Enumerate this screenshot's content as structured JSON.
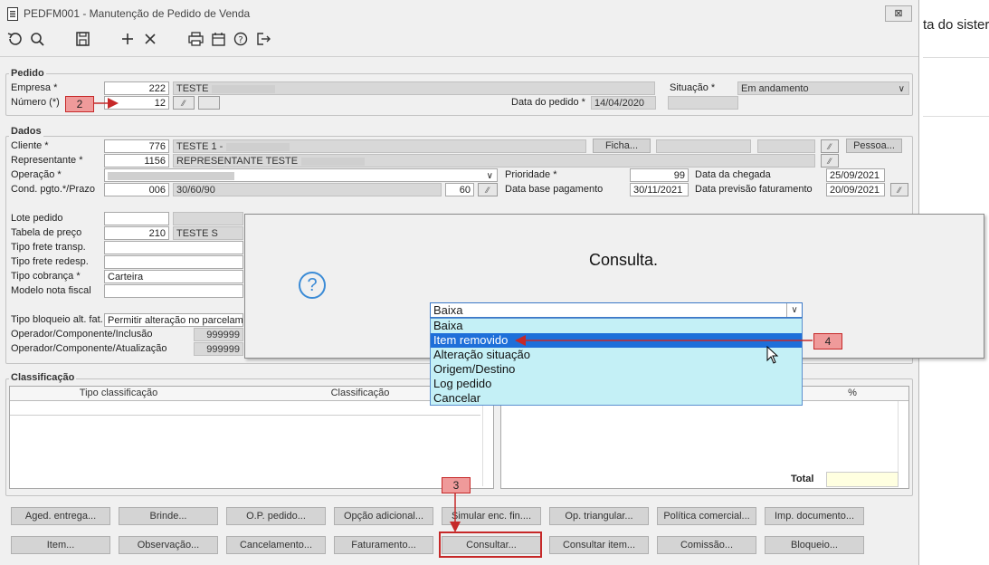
{
  "window": {
    "title": "PEDFM001 - Manutenção de Pedido de Venda",
    "close_label": "⊠"
  },
  "toolbar": {
    "icons": [
      "undo-icon",
      "search-icon",
      "save-icon",
      "add-icon",
      "delete-icon",
      "print-icon",
      "calendar-icon",
      "help-icon",
      "exit-icon"
    ]
  },
  "pedido": {
    "group": "Pedido",
    "empresa_label": "Empresa *",
    "empresa_code": "222",
    "empresa_name": "TESTE",
    "numero_label": "Número (*)",
    "numero_value": "12",
    "situacao_label": "Situação *",
    "situacao_value": "Em andamento",
    "data_label": "Data do pedido *",
    "data_value": "14/04/2020"
  },
  "dados": {
    "group": "Dados",
    "cliente_label": "Cliente *",
    "cliente_code": "776",
    "cliente_name": "TESTE 1 -",
    "ficha_label": "Ficha...",
    "pessoa_label": "Pessoa...",
    "representante_label": "Representante *",
    "representante_code": "1156",
    "representante_name": "REPRESENTANTE TESTE",
    "operacao_label": "Operação *",
    "cond_label": "Cond. pgto.*/Prazo",
    "cond_code": "006",
    "cond_desc": "30/60/90",
    "prazo": "60",
    "prioridade_label": "Prioridade *",
    "prioridade_value": "99",
    "data_base_label": "Data base pagamento",
    "data_base_value": "30/11/2021",
    "data_chegada_label": "Data da chegada",
    "data_chegada_value": "25/09/2021",
    "data_prev_label": "Data previsão faturamento",
    "data_prev_value": "20/09/2021",
    "lote_label": "Lote pedido",
    "tabela_label": "Tabela de preço",
    "tabela_code": "210",
    "tabela_name": "TESTE S",
    "frete_transp_label": "Tipo frete transp.",
    "frete_redesp_label": "Tipo frete redesp.",
    "cobranca_label": "Tipo cobrança *",
    "cobranca_value": "Carteira",
    "modelo_label": "Modelo nota fiscal",
    "bloqueio_label": "Tipo bloqueio alt. fat.",
    "bloqueio_value": "Permitir alteração no parcelame",
    "op_inclusao_label": "Operador/Componente/Inclusão",
    "op_inclusao_value": "999999",
    "op_atualizacao_label": "Operador/Componente/Atualização",
    "op_atualizacao_value": "999999"
  },
  "classificacao": {
    "group": "Classificação",
    "col1": "Tipo classificação",
    "col2": "Classificação",
    "pct_header": "%",
    "total_label": "Total"
  },
  "buttons_row1": [
    "Aged. entrega...",
    "Brinde...",
    "O.P. pedido...",
    "Opção adicional...",
    "Simular enc. fin....",
    "Op. triangular...",
    "Política comercial...",
    "Imp. documento..."
  ],
  "buttons_row2": [
    "Item...",
    "Observação...",
    "Cancelamento...",
    "Faturamento...",
    "Consultar...",
    "Consultar item...",
    "Comissão...",
    "Bloqueio..."
  ],
  "dialog": {
    "title": "Consulta.",
    "selected": "Baixa",
    "options": [
      "Baixa",
      "Item removido",
      "Alteração situação",
      "Origem/Destino",
      "Log pedido",
      "Cancelar"
    ],
    "highlighted_index": 1
  },
  "callouts": [
    "2",
    "3",
    "4"
  ],
  "background_window": {
    "text": "ta do sister"
  },
  "colors": {
    "annotation_red": "#c62828",
    "dropdown_bg": "#c4f0f6",
    "selection_blue": "#1e6fd9"
  }
}
